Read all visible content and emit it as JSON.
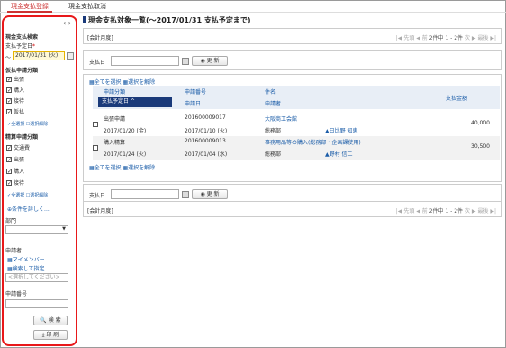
{
  "tabs": [
    "現金支払登録",
    "現金支払取消"
  ],
  "sidebar": {
    "section_title": "現金支払検索",
    "due_date_label": "支払予定日",
    "required_mark": "*",
    "date_prefix": "〜",
    "date_value": "2017/01/31 (火)",
    "provisional_section": "仮払申請分類",
    "provisional_items": [
      "出張",
      "購入",
      "接待",
      "仮払"
    ],
    "select_all": "全選択",
    "deselect_all": "選択解除",
    "settle_section": "精算申請分類",
    "settle_items": [
      "交通費",
      "出張",
      "購入",
      "接待"
    ],
    "more_conditions": "条件を詳しく...",
    "dept_label": "部門",
    "applicant_label": "申請者",
    "my_members": "マイメンバー",
    "search_and_set": "検索して指定",
    "select_placeholder": "<選択してください>",
    "appno_label": "申請番号",
    "search_button": "検 索",
    "print_button": "印 刷"
  },
  "main": {
    "title": "現金支払対象一覧(〜2017/01/31 支払予定まで)",
    "accounting_month": "[会計月度]",
    "pager": {
      "first": "先頭",
      "prev": "前",
      "range": "2件中 1 - 2件",
      "next": "次",
      "last": "最後"
    },
    "payment_date_label": "支払日",
    "update_button": "更 新",
    "select_all_link": "全てを選択",
    "deselect_all_link": "選択を解除",
    "columns": {
      "category": "申請分類",
      "due_date": "支払予定日",
      "app_no": "申請番号",
      "app_date": "申請日",
      "name": "件名",
      "applicant": "申請者",
      "amount": "支払金額"
    },
    "rows": [
      {
        "category": "出張申請",
        "due_date": "2017/01/20 (金)",
        "app_no": "201600009017",
        "app_date": "2017/01/10 (火)",
        "name": "大阪商工会館",
        "dept": "総務部",
        "applicant": "日比野 知恵",
        "amount": "40,000"
      },
      {
        "category": "購入精算",
        "due_date": "2017/01/24 (火)",
        "app_no": "201600009013",
        "app_date": "2017/01/04 (水)",
        "name": "事務用品等の購入(総務部・企画課使用)",
        "dept": "総務部",
        "applicant": "野村 信二",
        "amount": "30,500"
      }
    ]
  }
}
